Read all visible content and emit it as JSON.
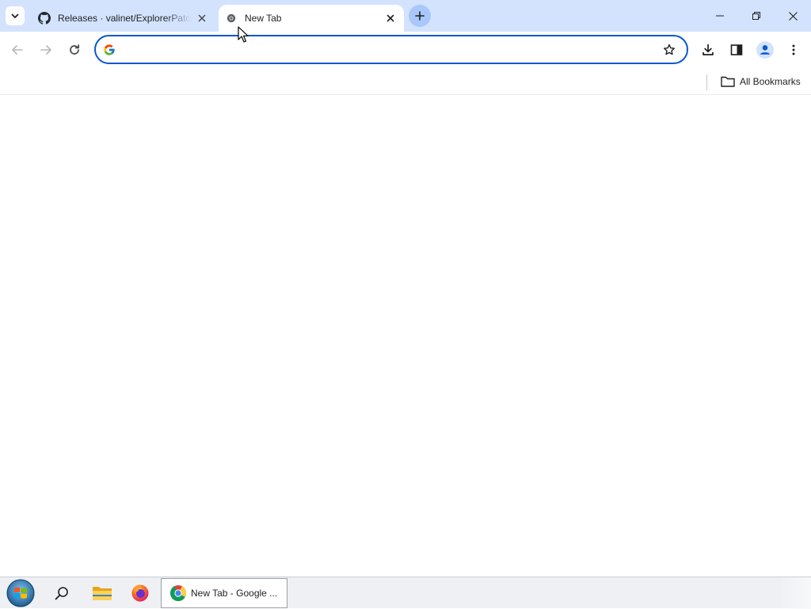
{
  "tabs": [
    {
      "title": "Releases · valinet/ExplorerPatcher",
      "favicon": "github-icon",
      "active": false
    },
    {
      "title": "New Tab",
      "favicon": "chrome-newtab-icon",
      "active": true
    }
  ],
  "toolbar": {
    "omnibox_value": "",
    "omnibox_placeholder": ""
  },
  "bookmarks": {
    "all_bookmarks_label": "All Bookmarks"
  },
  "taskbar": {
    "task_label": "New Tab - Google ..."
  },
  "colors": {
    "tabstrip_bg": "#d3e3fd",
    "omnibox_border": "#0b57d0",
    "newtab_button": "#a8c7fa"
  }
}
